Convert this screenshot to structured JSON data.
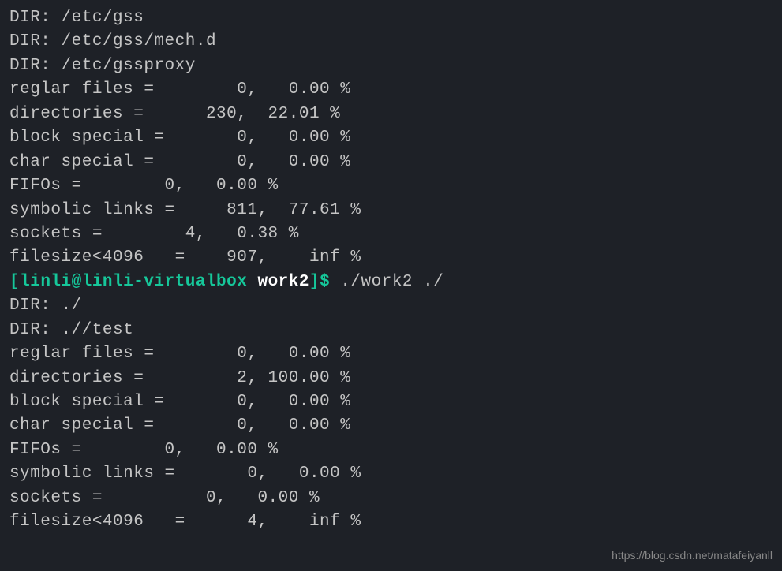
{
  "output1": {
    "lines": [
      "DIR: /etc/gss",
      "DIR: /etc/gss/mech.d",
      "DIR: /etc/gssproxy",
      "reglar files =        0,   0.00 %",
      "directories =      230,  22.01 %",
      "block special =       0,   0.00 %",
      "char special =        0,   0.00 %",
      "FIFOs =        0,   0.00 %",
      "symbolic links =     811,  77.61 %",
      "sockets =        4,   0.38 %",
      "filesize<4096   =    907,    inf %"
    ]
  },
  "prompt": {
    "open_bracket": "[",
    "user_host": "linli@linli-virtualbox",
    "space": " ",
    "dir": "work2",
    "close_bracket": "]",
    "dollar": "$",
    "post_dollar_space": " ",
    "command": "./work2 ./"
  },
  "output2": {
    "lines": [
      "DIR: ./",
      "DIR: .//test",
      "reglar files =        0,   0.00 %",
      "directories =         2, 100.00 %",
      "block special =       0,   0.00 %",
      "char special =        0,   0.00 %",
      "FIFOs =        0,   0.00 %",
      "symbolic links =       0,   0.00 %",
      "sockets =          0,   0.00 %",
      "filesize<4096   =      4,    inf %"
    ]
  },
  "watermark": "https://blog.csdn.net/matafeiyanll"
}
